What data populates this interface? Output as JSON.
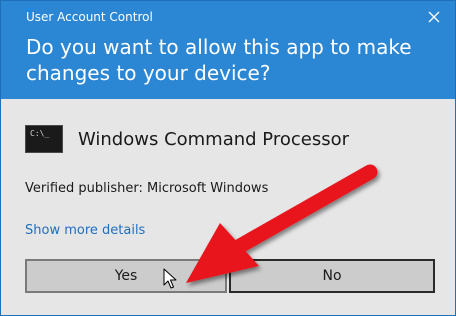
{
  "window": {
    "title": "User Account Control",
    "close_icon": "close-icon"
  },
  "prompt": {
    "question": "Do you want to allow this app to make changes to your device?"
  },
  "app": {
    "icon": "command-prompt-icon",
    "icon_text": "C:\\_",
    "name": "Windows Command Processor",
    "publisher": "Verified publisher: Microsoft Windows"
  },
  "details_link": "Show more details",
  "buttons": {
    "yes_label": "Yes",
    "no_label": "No"
  },
  "colors": {
    "header_bg": "#2b86d4",
    "body_bg": "#e6e6e6",
    "link": "#1f6fc0",
    "annotation_arrow": "#e8181f"
  }
}
